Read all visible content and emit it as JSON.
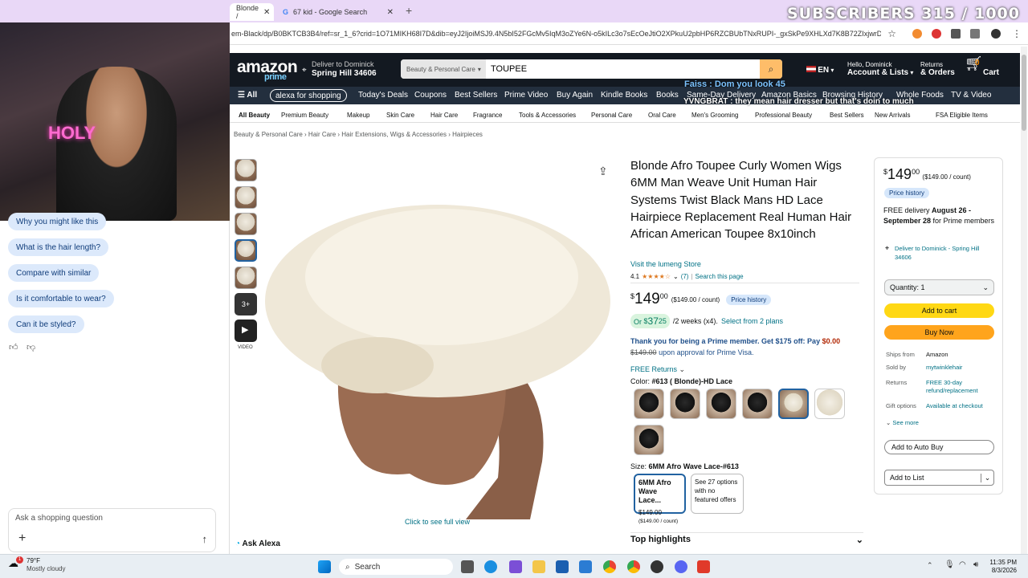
{
  "browser": {
    "tabs": [
      {
        "label": "Blonde /"
      },
      {
        "label": "67 kid - Google Search"
      }
    ],
    "url": "em-Black/dp/B0BKTCB3B4/ref=sr_1_6?crid=1O71MIKH68I7D&dib=eyJ2IjoiMSJ9.4N5bI52FGcMv5IqM3oZYe6N-o5kILc3o7sEcOeJtiO2XPkuU2pbHP6RZCBUbTNxRUPI-_gxSkPe9XHLXd7K8B72ZIxjwrDc...",
    "subscribers_overlay": "SUBSCRIBERS 315 / 1000"
  },
  "assistant": {
    "chips": [
      "Why you might like this",
      "What is the hair length?",
      "Compare with similar",
      "Is it comfortable to wear?",
      "Can it be styled?"
    ],
    "input_placeholder": "Ask a shopping question",
    "webcam_neon": "HOLY"
  },
  "amazon": {
    "logo": "amazon",
    "logo_sub": "prime",
    "deliver_line1": "Deliver to Dominick",
    "deliver_line2": "Spring Hill 34606",
    "search_category": "Beauty & Personal Care",
    "search_value": "TOUPEE",
    "lang": "EN",
    "account_line1": "Hello, Dominick",
    "account_line2": "Account & Lists",
    "returns_line1": "Returns",
    "returns_line2": "& Orders",
    "cart_count": "0",
    "cart_label": "Cart",
    "nav_all": "All",
    "nav_alexa": "alexa for shopping",
    "nav_items": [
      "Today's Deals",
      "Coupons",
      "Best Sellers",
      "Prime Video",
      "Buy Again",
      "Kindle Books",
      "Books",
      "Same-Day Delivery",
      "Amazon Basics",
      "Browsing History",
      "Whole Foods",
      "TV & Video"
    ],
    "chat_overlay_1": "Faiss : Dom you look 45",
    "chat_overlay_2": "YVNGBRAT : they mean hair dresser but that's doin to much",
    "subnav": [
      "All Beauty",
      "Premium Beauty",
      "Makeup",
      "Skin Care",
      "Hair Care",
      "Fragrance",
      "Tools & Accessories",
      "Personal Care",
      "Oral Care",
      "Men's Grooming",
      "Professional Beauty",
      "Best Sellers",
      "New Arrivals",
      "FSA Eligible Items"
    ],
    "breadcrumb": "Beauty & Personal Care › Hair Care › Hair Extensions, Wigs & Accessories › Hairpieces"
  },
  "product": {
    "title": "Blonde Afro Toupee Curly Women Wigs 6MM Man Weave Unit Human Hair Systems Twist Black Mans HD Lace Hairpiece Replacement Real Human Hair African American Toupee 8x10inch",
    "store": "Visit the lumeng Store",
    "rating": "4.1",
    "stars": "★★★★☆",
    "review_count": "(7)",
    "search_page": "Search this page",
    "more_thumbs": "3+",
    "video_label": "VIDEO",
    "full_view": "Click to see full view",
    "price_symbol": "$",
    "price_whole": "149",
    "price_frac": "00",
    "price_per": "($149.00 / count)",
    "price_history": "Price history",
    "plan_or": "Or",
    "plan_whole": "37",
    "plan_frac": "25",
    "plan_text": "/2 weeks (x4).",
    "plan_link": "Select from 2 plans",
    "prime_msg": "Thank you for being a Prime member. Get $175 off: Pay",
    "prime_pay": "$0.00",
    "prime_strike": "$149.00",
    "prime_tail": "upon approval for Prime Visa.",
    "free_returns": "FREE Returns",
    "color_label": "Color:",
    "color_value": "#613 ( Blonde)-HD Lace",
    "size_label": "Size:",
    "size_value": "6MM Afro Wave Lace-#613",
    "size_opt1_name": "6MM Afro Wave Lace...",
    "size_opt1_price": "$149.00",
    "size_opt1_per": "($149.00 / count)",
    "size_opt2": "See 27 options with no featured offers",
    "top_highlights": "Top highlights",
    "ask_alexa": "Ask Alexa"
  },
  "buybox": {
    "price_whole": "149",
    "price_frac": "00",
    "price_per": "($149.00 / count)",
    "price_history": "Price history",
    "delivery_pre": "FREE delivery",
    "delivery_dates": "August 26 - September 28",
    "delivery_post": "for Prime members",
    "deliver_to": "Deliver to Dominick - Spring Hill 34606",
    "quantity": "Quantity: 1",
    "add_to_cart": "Add to cart",
    "buy_now": "Buy Now",
    "ships_from_k": "Ships from",
    "ships_from_v": "Amazon",
    "sold_by_k": "Sold by",
    "sold_by_v": "mytwinklehair",
    "returns_k": "Returns",
    "returns_v": "FREE 30-day refund/replacement",
    "gift_k": "Gift options",
    "gift_v": "Available at checkout",
    "see_more": "See more",
    "auto_buy": "Add to Auto Buy",
    "add_to_list": "Add to List"
  },
  "taskbar": {
    "weather_temp": "79°F",
    "weather_desc": "Mostly cloudy",
    "search": "Search",
    "time": "11:35 PM",
    "date": "8/3/2026",
    "notification": "1"
  },
  "colors": {
    "amazon_dark": "#131921",
    "amazon_nav": "#232f3e",
    "add_to_cart": "#ffd814",
    "buy_now": "#ffa41c",
    "link": "#007185"
  }
}
